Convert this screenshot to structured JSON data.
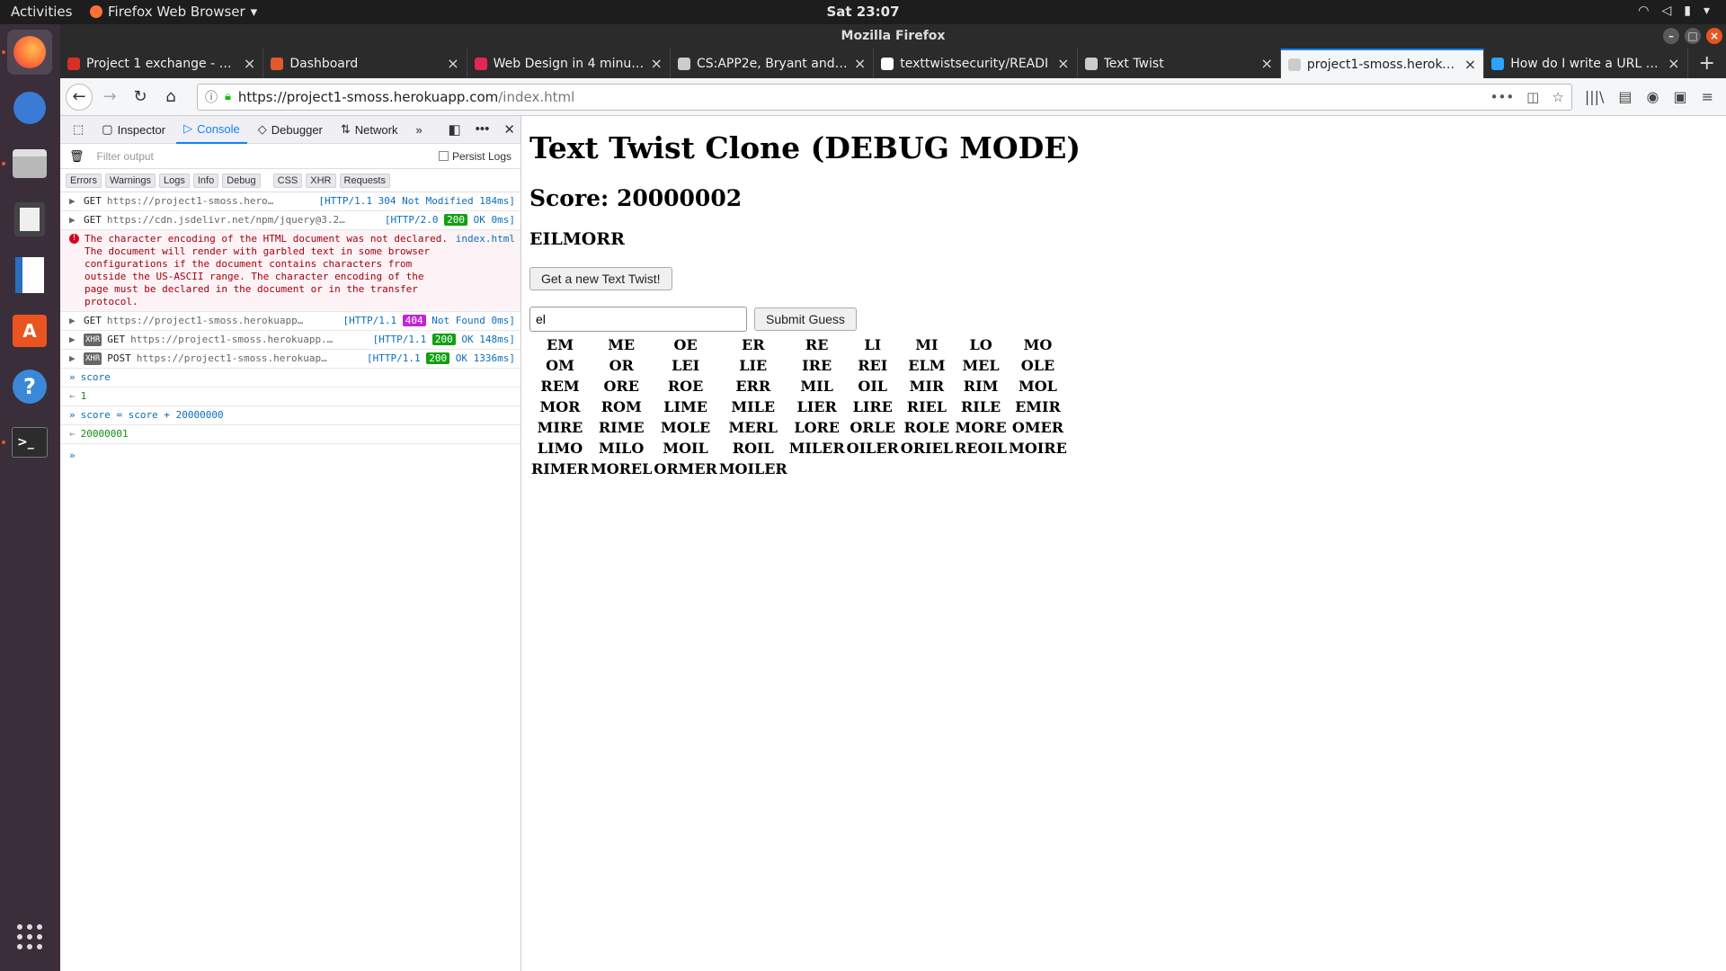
{
  "topbar": {
    "activities": "Activities",
    "app_name": "Firefox Web Browser",
    "clock": "Sat 23:07"
  },
  "window": {
    "title": "Mozilla Firefox"
  },
  "tabs": [
    {
      "title": "Project 1 exchange - dav",
      "favicon_color": "#d93025",
      "active": false
    },
    {
      "title": "Dashboard",
      "favicon_color": "#e05a2b",
      "active": false
    },
    {
      "title": "Web Design in 4 minutes",
      "favicon_color": "#e2265a",
      "active": false
    },
    {
      "title": "CS:APP2e, Bryant and O'Hal",
      "favicon_color": "#cccccc",
      "active": false
    },
    {
      "title": "texttwistsecurity/READI",
      "favicon_color": "#ffffff",
      "active": false
    },
    {
      "title": "Text Twist",
      "favicon_color": "#cccccc",
      "active": false
    },
    {
      "title": "project1-smoss.herokuapp",
      "favicon_color": "#cccccc",
      "active": true
    },
    {
      "title": "How do I write a URL in M",
      "favicon_color": "#2aa4ff",
      "active": false
    }
  ],
  "navbar": {
    "url_host": "https://project1-smoss.herokuapp.com",
    "url_path": "/index.html"
  },
  "devtools": {
    "tabs": [
      "Inspector",
      "Console",
      "Debugger",
      "Network"
    ],
    "active_tab": "Console",
    "filter_placeholder": "Filter output",
    "persist_logs": "Persist Logs",
    "levels": [
      "Errors",
      "Warnings",
      "Logs",
      "Info",
      "Debug"
    ],
    "levels2": [
      "CSS",
      "XHR",
      "Requests"
    ],
    "logs": [
      {
        "kind": "net",
        "xhr": false,
        "method": "GET",
        "url": "https://project1-smoss.hero…",
        "proto": "[HTTP/1.1",
        "code": "304",
        "code_badge": false,
        "text": "Not Modified 184ms]"
      },
      {
        "kind": "net",
        "xhr": false,
        "method": "GET",
        "url": "https://cdn.jsdelivr.net/npm/jquery@3.2…",
        "proto": "[HTTP/2.0",
        "code": "200",
        "code_badge": true,
        "text": "OK 0ms]"
      },
      {
        "kind": "err",
        "msg": "The character encoding of the HTML document was not declared. The document will render with garbled text in some browser configurations if the document contains characters from outside the US-ASCII range. The character encoding of the page must be declared in the document or in the transfer protocol.",
        "src": "index.html"
      },
      {
        "kind": "net",
        "xhr": false,
        "method": "GET",
        "url": "https://project1-smoss.herokuapp…",
        "proto": "[HTTP/1.1",
        "code": "404",
        "code_badge": true,
        "badge_type": "nf",
        "text": "Not Found 0ms]"
      },
      {
        "kind": "net",
        "xhr": true,
        "method": "GET",
        "url": "https://project1-smoss.herokuapp.…",
        "proto": "[HTTP/1.1",
        "code": "200",
        "code_badge": true,
        "text": "OK 148ms]"
      },
      {
        "kind": "net",
        "xhr": true,
        "method": "POST",
        "url": "https://project1-smoss.herokuap…",
        "proto": "[HTTP/1.1",
        "code": "200",
        "code_badge": true,
        "text": "OK 1336ms]"
      },
      {
        "kind": "input",
        "text": "score"
      },
      {
        "kind": "output",
        "text": "1"
      },
      {
        "kind": "input",
        "text": "score = score + 20000000"
      },
      {
        "kind": "output",
        "text": "20000001"
      }
    ]
  },
  "page": {
    "title": "Text Twist Clone (DEBUG MODE)",
    "score": "Score: 20000002",
    "letters": "EILMORR",
    "new_button": "Get a new Text Twist!",
    "guess_value": "el",
    "submit_button": "Submit Guess",
    "words": [
      [
        "EM",
        "ME",
        "OE",
        "ER",
        "RE",
        "LI",
        "MI",
        "LO",
        "MO"
      ],
      [
        "OM",
        "OR",
        "LEI",
        "LIE",
        "IRE",
        "REI",
        "ELM",
        "MEL",
        "OLE"
      ],
      [
        "REM",
        "ORE",
        "ROE",
        "ERR",
        "MIL",
        "OIL",
        "MIR",
        "RIM",
        "MOL"
      ],
      [
        "MOR",
        "ROM",
        "LIME",
        "MILE",
        "LIER",
        "LIRE",
        "RIEL",
        "RILE",
        "EMIR"
      ],
      [
        "MIRE",
        "RIME",
        "MOLE",
        "MERL",
        "LORE",
        "ORLE",
        "ROLE",
        "MORE",
        "OMER"
      ],
      [
        "LIMO",
        "MILO",
        "MOIL",
        "ROIL",
        "MILER",
        "OILER",
        "ORIEL",
        "REOIL",
        "MOIRE"
      ],
      [
        "RIMER",
        "MOREL",
        "ORMER",
        "MOILER"
      ]
    ]
  }
}
